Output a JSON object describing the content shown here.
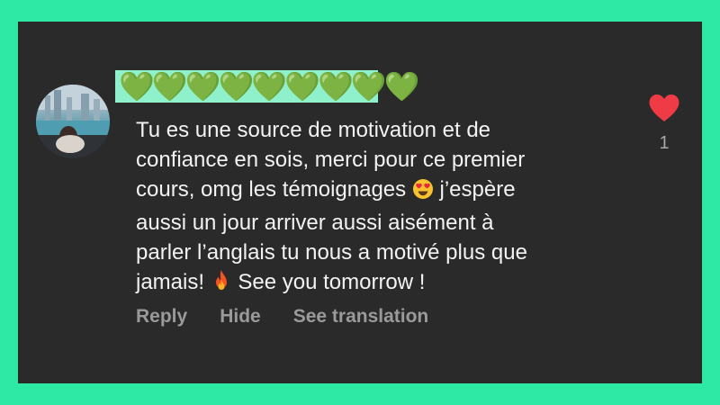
{
  "comment": {
    "username": "💚💚💚💚💚💚💚💚💚",
    "text_line1": "Tu es une source de motivation et de",
    "text_line2": "confiance en sois, merci pour ce premier",
    "text_line3a": "cours, omg les témoignages ",
    "text_line3b": " j’espère",
    "text_line4": "aussi un jour arriver aussi aisément à",
    "text_line5": "parler l’anglais tu nous a motivé plus que",
    "text_line6a": "jamais! ",
    "text_line6b": " See you tomorrow !",
    "emoji_1": "heart-eyes-emoji",
    "emoji_2": "fire-emoji"
  },
  "actions": {
    "reply": "Reply",
    "hide": "Hide",
    "translate": "See translation"
  },
  "like": {
    "icon": "heart-icon",
    "count": "1",
    "color": "#ef3b45"
  },
  "colors": {
    "background": "#2ee9a6",
    "card": "#2a2a2a",
    "text": "#f2f2f2",
    "muted": "#9a9a9a"
  }
}
